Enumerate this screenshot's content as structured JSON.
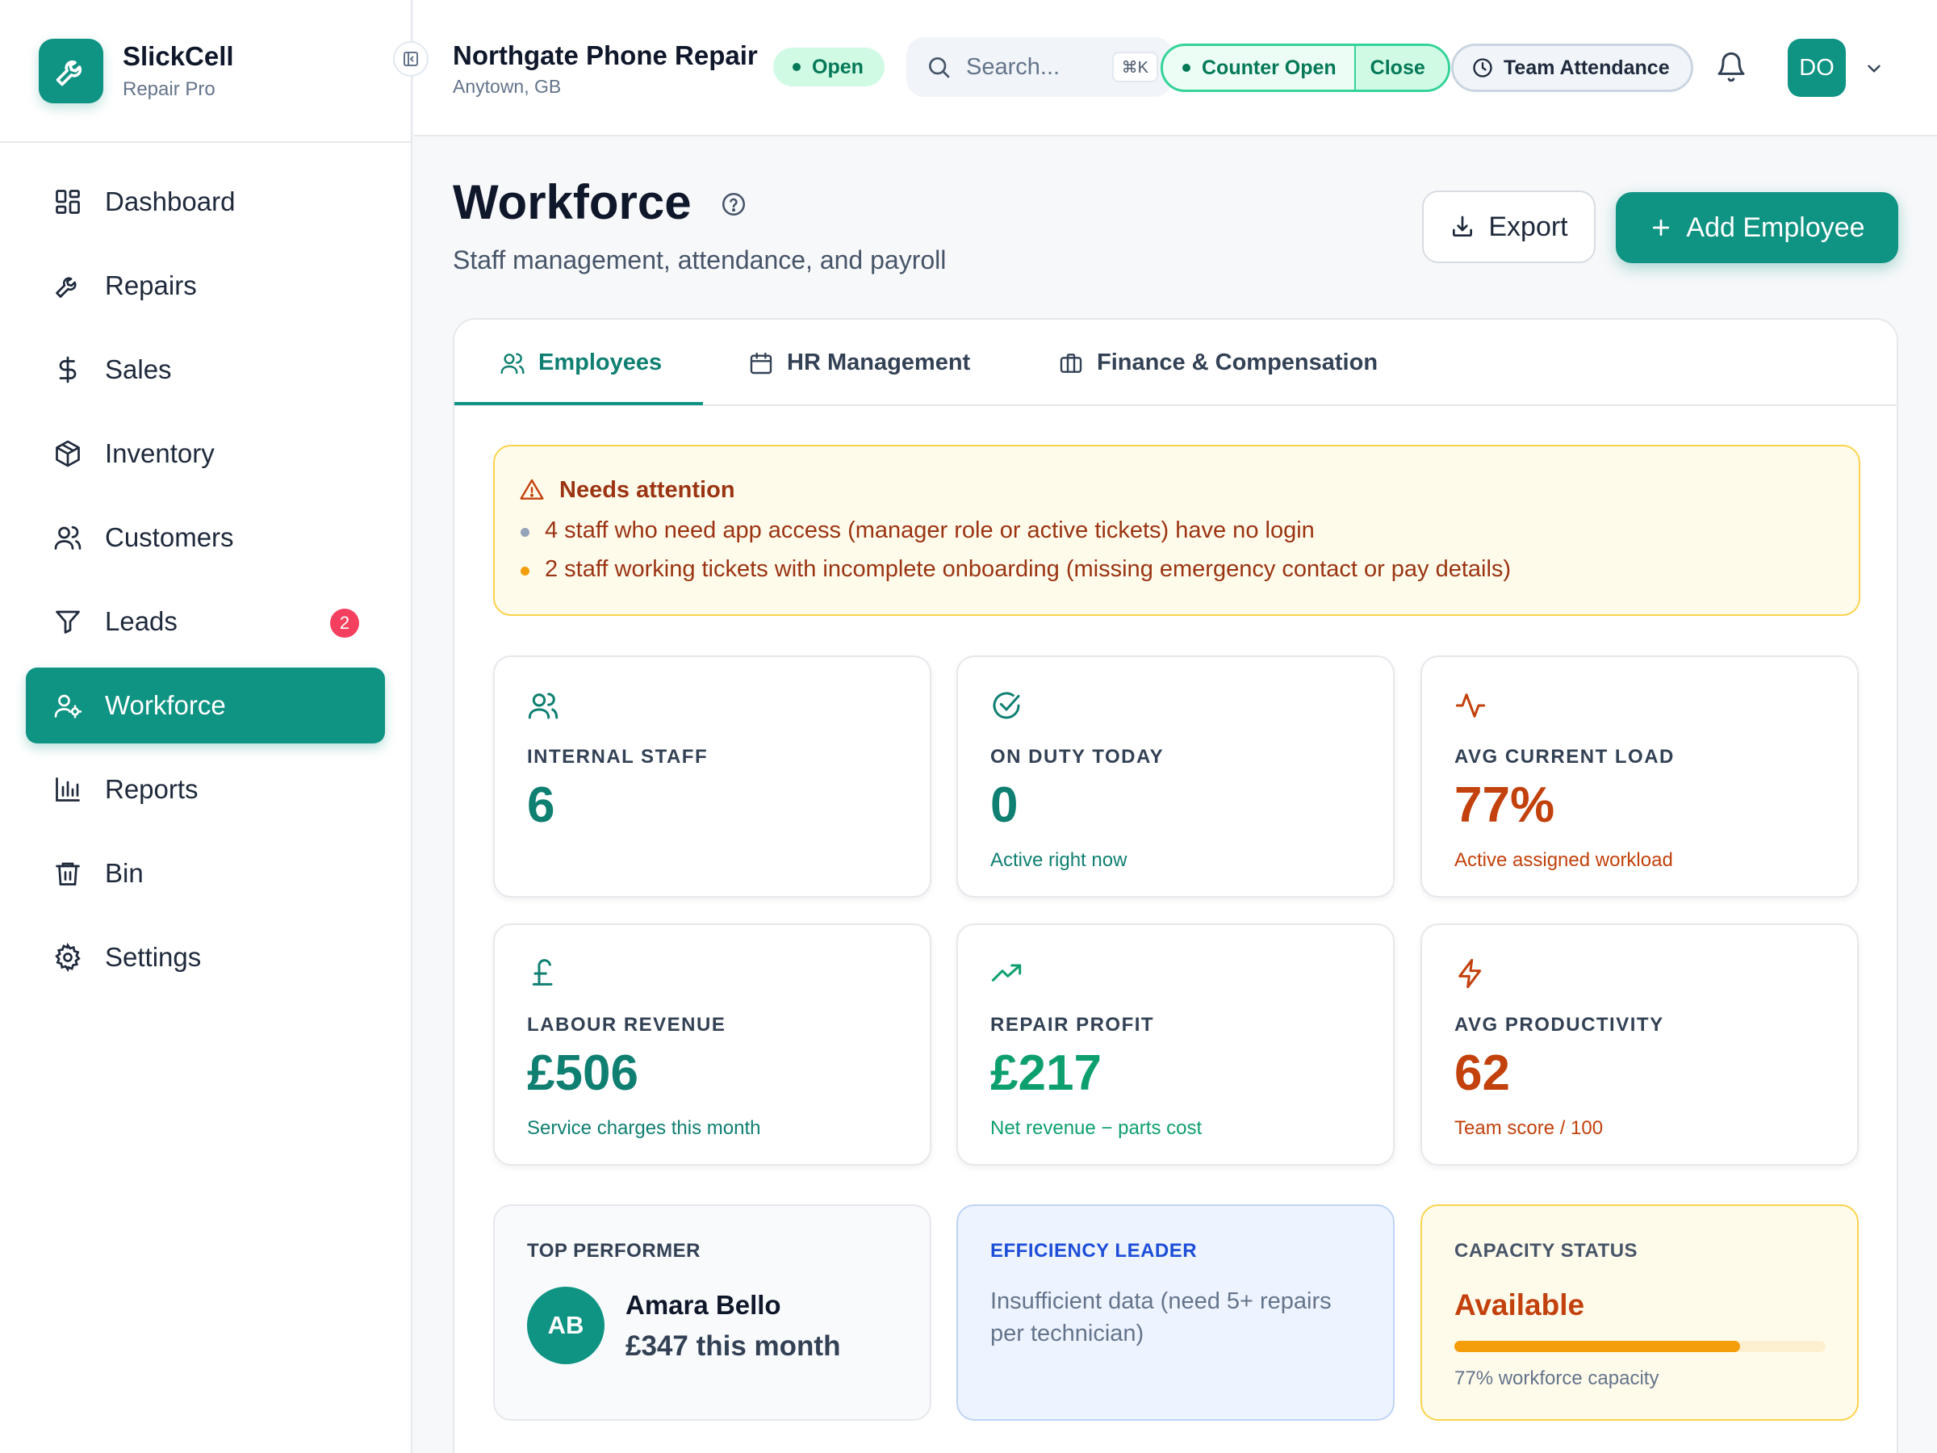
{
  "brand": {
    "name": "SlickCell",
    "subtitle": "Repair Pro"
  },
  "sidebar": {
    "items": [
      {
        "label": "Dashboard",
        "icon": "layout-grid-icon"
      },
      {
        "label": "Repairs",
        "icon": "wrench-icon"
      },
      {
        "label": "Sales",
        "icon": "dollar-icon"
      },
      {
        "label": "Inventory",
        "icon": "box-icon"
      },
      {
        "label": "Customers",
        "icon": "users-icon"
      },
      {
        "label": "Leads",
        "icon": "filter-icon",
        "badge": "2"
      },
      {
        "label": "Workforce",
        "icon": "user-cog-icon",
        "active": true
      },
      {
        "label": "Reports",
        "icon": "bar-chart-icon"
      },
      {
        "label": "Bin",
        "icon": "trash-icon"
      },
      {
        "label": "Settings",
        "icon": "gear-icon"
      }
    ]
  },
  "header": {
    "shop_name": "Northgate Phone Repair",
    "shop_location": "Anytown, GB",
    "status": "Open",
    "search_placeholder": "Search...",
    "search_shortcut": "⌘K",
    "counter_open": "Counter Open",
    "counter_close": "Close",
    "attendance": "Team Attendance",
    "user_initials": "DO"
  },
  "page": {
    "title": "Workforce",
    "subtitle": "Staff management, attendance, and payroll",
    "export_label": "Export",
    "add_label": "Add Employee"
  },
  "tabs": [
    {
      "label": "Employees",
      "icon": "users-icon",
      "active": true
    },
    {
      "label": "HR Management",
      "icon": "calendar-icon"
    },
    {
      "label": "Finance & Compensation",
      "icon": "briefcase-icon"
    }
  ],
  "alert": {
    "title": "Needs attention",
    "items": [
      "4 staff who need app access (manager role or active tickets) have no login",
      "2 staff working tickets with incomplete onboarding (missing emergency contact or pay details)"
    ]
  },
  "stats": [
    {
      "label": "INTERNAL STAFF",
      "value": "6",
      "note": ""
    },
    {
      "label": "ON DUTY TODAY",
      "value": "0",
      "note": "Active right now"
    },
    {
      "label": "AVG CURRENT LOAD",
      "value": "77%",
      "note": "Active assigned workload"
    },
    {
      "label": "LABOUR REVENUE",
      "value": "£506",
      "note": "Service charges this month"
    },
    {
      "label": "REPAIR PROFIT",
      "value": "£217",
      "note": "Net revenue − parts cost"
    },
    {
      "label": "AVG PRODUCTIVITY",
      "value": "62",
      "note": "Team score / 100"
    }
  ],
  "top_performer": {
    "label": "TOP PERFORMER",
    "initials": "AB",
    "name": "Amara Bello",
    "amount": "£347 this month"
  },
  "efficiency": {
    "label": "EFFICIENCY LEADER",
    "text": "Insufficient data (need 5+ repairs per technician)"
  },
  "capacity": {
    "label": "CAPACITY STATUS",
    "status": "Available",
    "percent": 77,
    "note": "77% workforce capacity"
  },
  "colors": {
    "accent": "#0f9383",
    "warning": "#c2410c",
    "alert_bg": "#fffbeb",
    "badge": "#f43f5e"
  }
}
